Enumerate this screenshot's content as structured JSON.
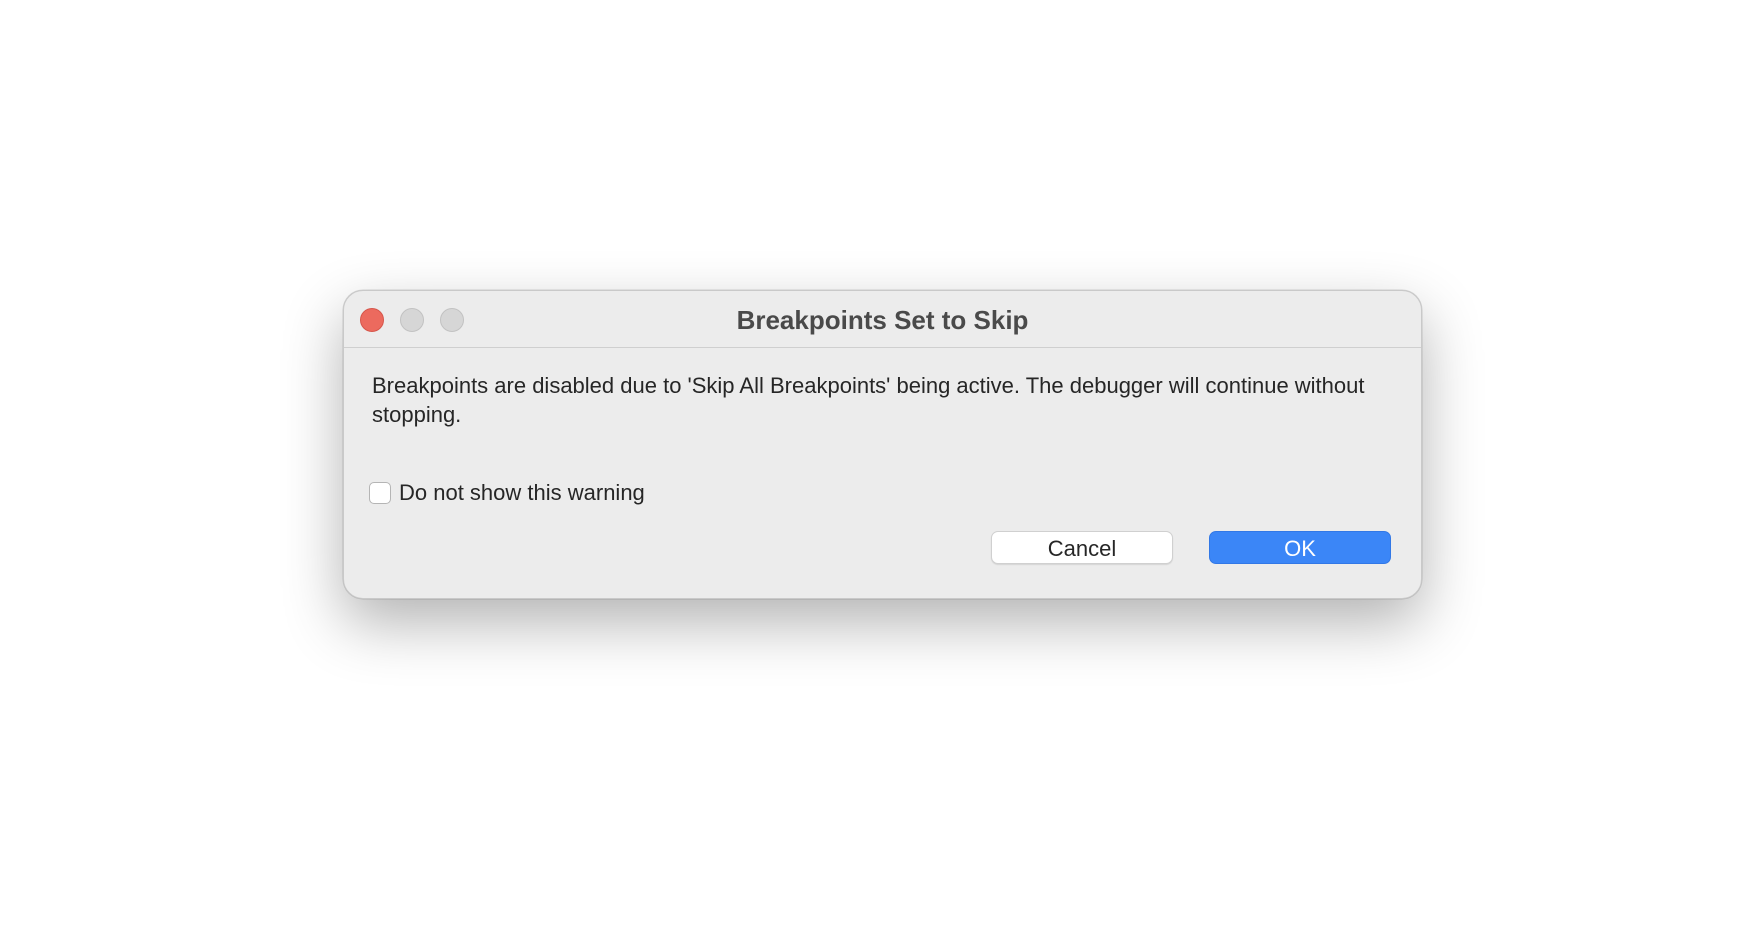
{
  "dialog": {
    "title": "Breakpoints Set to Skip",
    "message": "Breakpoints are disabled due to 'Skip All Breakpoints' being active. The debugger will continue without stopping.",
    "checkbox_label": "Do not show this warning",
    "checkbox_checked": false,
    "cancel_label": "Cancel",
    "ok_label": "OK"
  },
  "colors": {
    "close": "#ec6a5e",
    "accent": "#3b86f7",
    "background": "#ececec"
  }
}
